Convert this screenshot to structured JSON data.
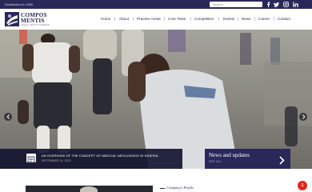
{
  "topbar": {
    "established": "Established in 1985",
    "search_placeholder": "Search",
    "social_icons": [
      "facebook-icon",
      "twitter-icon",
      "instagram-icon",
      "linkedin-icon"
    ]
  },
  "header": {
    "logo_line1": "COMPOS",
    "logo_line2": "MENTIS",
    "logo_tagline": "LEGAL PRACTITIONERS",
    "nav": [
      "Home",
      "About",
      "Practice Areas",
      "Core Team",
      "Competition",
      "Events",
      "News",
      "Career",
      "Contact"
    ]
  },
  "news": {
    "title": "AN OVERVIEW OF THE CONCEPT OF MEDICAL NEGLIGENCE IN NIGERIA",
    "date": "SEPTEMBER 14, 2023",
    "panel_title": "News and updates",
    "panel_link": "SEE ALL"
  },
  "profile": {
    "label": "Company's Profile"
  },
  "notification": {
    "count": "1"
  },
  "colors": {
    "brand": "#2a2859",
    "badge": "#e0261d"
  }
}
